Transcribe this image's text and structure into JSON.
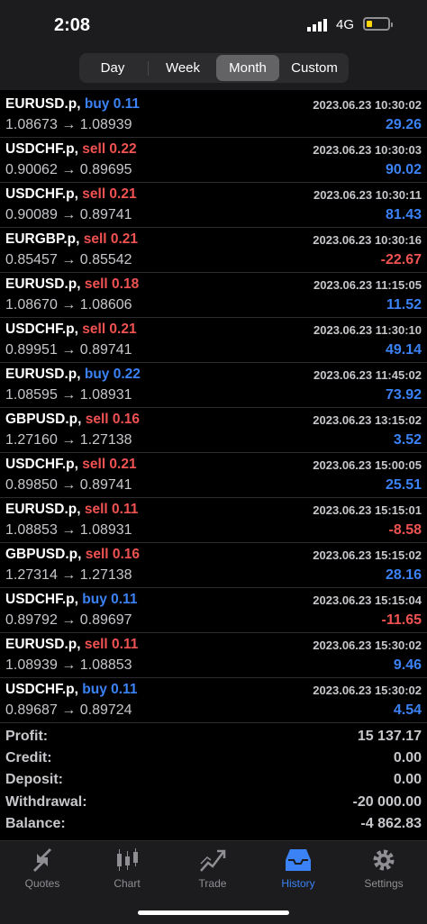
{
  "status_bar": {
    "time": "2:08",
    "network": "4G"
  },
  "period_tabs": [
    {
      "label": "Day",
      "active": false
    },
    {
      "label": "Week",
      "active": false
    },
    {
      "label": "Month",
      "active": true
    },
    {
      "label": "Custom",
      "active": false
    }
  ],
  "trades": [
    {
      "symbol": "EURUSD.p,",
      "side": "buy",
      "volume": "buy 0.11",
      "open": "1.08673",
      "close": "1.08939",
      "datetime": "2023.06.23 10:30:02",
      "profit": "29.26",
      "profit_sign": "pos"
    },
    {
      "symbol": "USDCHF.p,",
      "side": "sell",
      "volume": "sell 0.22",
      "open": "0.90062",
      "close": "0.89695",
      "datetime": "2023.06.23 10:30:03",
      "profit": "90.02",
      "profit_sign": "pos"
    },
    {
      "symbol": "USDCHF.p,",
      "side": "sell",
      "volume": "sell 0.21",
      "open": "0.90089",
      "close": "0.89741",
      "datetime": "2023.06.23 10:30:11",
      "profit": "81.43",
      "profit_sign": "pos"
    },
    {
      "symbol": "EURGBP.p,",
      "side": "sell",
      "volume": "sell 0.21",
      "open": "0.85457",
      "close": "0.85542",
      "datetime": "2023.06.23 10:30:16",
      "profit": "-22.67",
      "profit_sign": "neg"
    },
    {
      "symbol": "EURUSD.p,",
      "side": "sell",
      "volume": "sell 0.18",
      "open": "1.08670",
      "close": "1.08606",
      "datetime": "2023.06.23 11:15:05",
      "profit": "11.52",
      "profit_sign": "pos"
    },
    {
      "symbol": "USDCHF.p,",
      "side": "sell",
      "volume": "sell 0.21",
      "open": "0.89951",
      "close": "0.89741",
      "datetime": "2023.06.23 11:30:10",
      "profit": "49.14",
      "profit_sign": "pos"
    },
    {
      "symbol": "EURUSD.p,",
      "side": "buy",
      "volume": "buy 0.22",
      "open": "1.08595",
      "close": "1.08931",
      "datetime": "2023.06.23 11:45:02",
      "profit": "73.92",
      "profit_sign": "pos"
    },
    {
      "symbol": "GBPUSD.p,",
      "side": "sell",
      "volume": "sell 0.16",
      "open": "1.27160",
      "close": "1.27138",
      "datetime": "2023.06.23 13:15:02",
      "profit": "3.52",
      "profit_sign": "pos"
    },
    {
      "symbol": "USDCHF.p,",
      "side": "sell",
      "volume": "sell 0.21",
      "open": "0.89850",
      "close": "0.89741",
      "datetime": "2023.06.23 15:00:05",
      "profit": "25.51",
      "profit_sign": "pos"
    },
    {
      "symbol": "EURUSD.p,",
      "side": "sell",
      "volume": "sell 0.11",
      "open": "1.08853",
      "close": "1.08931",
      "datetime": "2023.06.23 15:15:01",
      "profit": "-8.58",
      "profit_sign": "neg"
    },
    {
      "symbol": "GBPUSD.p,",
      "side": "sell",
      "volume": "sell 0.16",
      "open": "1.27314",
      "close": "1.27138",
      "datetime": "2023.06.23 15:15:02",
      "profit": "28.16",
      "profit_sign": "pos"
    },
    {
      "symbol": "USDCHF.p,",
      "side": "buy",
      "volume": "buy 0.11",
      "open": "0.89792",
      "close": "0.89697",
      "datetime": "2023.06.23 15:15:04",
      "profit": "-11.65",
      "profit_sign": "neg"
    },
    {
      "symbol": "EURUSD.p,",
      "side": "sell",
      "volume": "sell 0.11",
      "open": "1.08939",
      "close": "1.08853",
      "datetime": "2023.06.23 15:30:02",
      "profit": "9.46",
      "profit_sign": "pos"
    },
    {
      "symbol": "USDCHF.p,",
      "side": "buy",
      "volume": "buy 0.11",
      "open": "0.89687",
      "close": "0.89724",
      "datetime": "2023.06.23 15:30:02",
      "profit": "4.54",
      "profit_sign": "pos"
    }
  ],
  "summary": [
    {
      "label": "Profit:",
      "value": "15 137.17"
    },
    {
      "label": "Credit:",
      "value": "0.00"
    },
    {
      "label": "Deposit:",
      "value": "0.00"
    },
    {
      "label": "Withdrawal:",
      "value": "-20 000.00"
    },
    {
      "label": "Balance:",
      "value": "-4 862.83"
    }
  ],
  "tab_bar": [
    {
      "label": "Quotes",
      "icon": "quotes-icon",
      "active": false
    },
    {
      "label": "Chart",
      "icon": "chart-icon",
      "active": false
    },
    {
      "label": "Trade",
      "icon": "trade-icon",
      "active": false
    },
    {
      "label": "History",
      "icon": "history-icon",
      "active": true
    },
    {
      "label": "Settings",
      "icon": "gear-icon",
      "active": false
    }
  ],
  "colors": {
    "buy": "#3b82f6",
    "sell": "#f05252",
    "accent": "#3b82f6",
    "background": "#000000"
  }
}
